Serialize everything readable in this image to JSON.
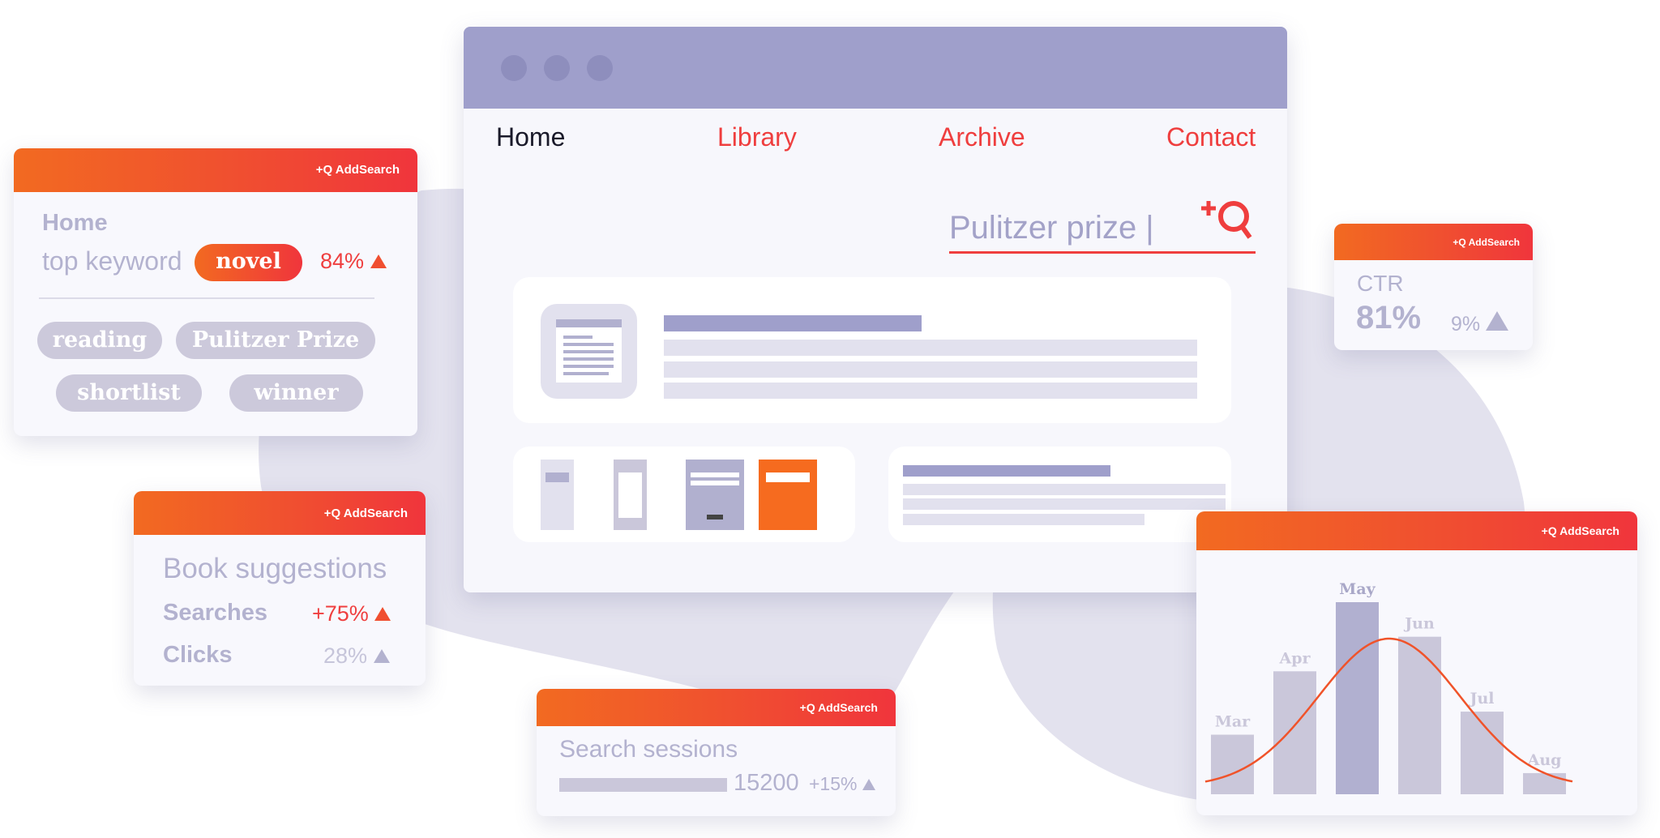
{
  "brand": {
    "label": "+Q AddSearch",
    "accent": "#f04f30",
    "gradient": [
      "#f26a21",
      "#f0353c"
    ]
  },
  "browser": {
    "window_dots": 3,
    "nav": [
      {
        "label": "Home",
        "active": true
      },
      {
        "label": "Library"
      },
      {
        "label": "Archive"
      },
      {
        "label": "Contact"
      }
    ],
    "search": {
      "value": "Pulitzer prize |",
      "icon": "addsearch-plus-magnifier-icon"
    }
  },
  "keyword_widget": {
    "title": "Home",
    "subtitle": "top keyword",
    "keyword": "novel",
    "percent": "84%",
    "trend": "up",
    "tags": [
      "reading",
      "Pulitzer Prize",
      "shortlist",
      "winner"
    ]
  },
  "suggestions_widget": {
    "title": "Book suggestions",
    "rows": [
      {
        "label": "Searches",
        "value": "+75%",
        "trend": "up",
        "color": "#ef3e3e"
      },
      {
        "label": "Clicks",
        "value": "28%",
        "trend": "up",
        "color": "#b3b2cf"
      }
    ]
  },
  "sessions_widget": {
    "title": "Search sessions",
    "value": "15200",
    "change": "+15%",
    "trend": "up"
  },
  "ctr_widget": {
    "title": "CTR",
    "value": "81%",
    "change": "9%",
    "trend": "up"
  },
  "chart_data": {
    "type": "bar",
    "categories": [
      "Mar",
      "Apr",
      "May",
      "Jun",
      "Jul",
      "Aug"
    ],
    "values": [
      31,
      64,
      100,
      82,
      43,
      11
    ],
    "highlight": "May",
    "trend_line": "bell-curve",
    "colors": {
      "bar": "#cac7da",
      "highlight": "#b1b0d0",
      "line": "#f0532a"
    }
  }
}
